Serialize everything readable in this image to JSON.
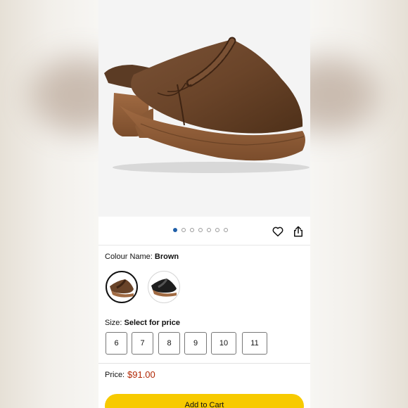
{
  "colour": {
    "label": "Colour Name:",
    "value": "Brown",
    "swatches": [
      "Brown",
      "Black"
    ]
  },
  "carousel": {
    "image_count": 7,
    "active_index": 0
  },
  "size": {
    "label": "Size:",
    "prompt": "Select for price",
    "options": [
      "6",
      "7",
      "8",
      "9",
      "10",
      "11"
    ]
  },
  "price": {
    "label": "Price:",
    "value": "$91.00"
  },
  "cart": {
    "label": "Add to Cart"
  },
  "icons": {
    "wishlist": "heart-icon",
    "share": "share-icon"
  },
  "colors": {
    "accent": "#f7ca00",
    "price": "#b12704",
    "active_dot": "#1f5fa8"
  }
}
